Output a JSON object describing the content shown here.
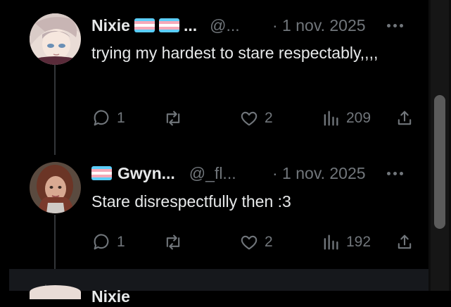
{
  "tweets": [
    {
      "name": "Nixie",
      "handle": "@...",
      "time": "· 1 nov. 2025",
      "text": "trying my hardest to stare respectably,,,,",
      "replies": "1",
      "likes": "2",
      "views": "209"
    },
    {
      "name": "Gwyn...",
      "handle": "@_fl...",
      "time": "· 1 nov. 2025",
      "text": "Stare disrespectfully then :3",
      "replies": "1",
      "likes": "2",
      "views": "192"
    }
  ],
  "peek": {
    "name": "Nixie"
  },
  "colors": {
    "flag_blue": "#5bcefa",
    "flag_pink": "#f5a9b8",
    "flag_white": "#ffffff",
    "muted": "#71767b",
    "text": "#e7e9ea",
    "background": "#000000"
  },
  "icons": [
    "reply-icon",
    "retweet-icon",
    "like-icon",
    "views-icon",
    "share-icon",
    "more-icon"
  ]
}
